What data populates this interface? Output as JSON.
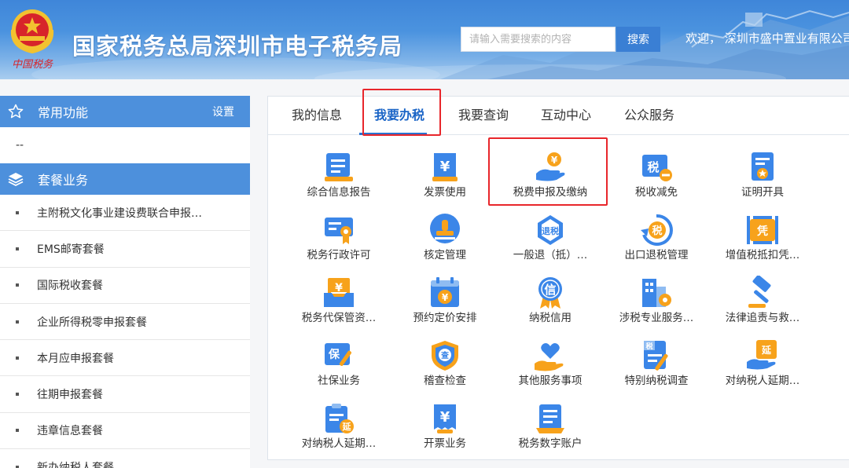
{
  "header": {
    "site_title": "国家税务总局深圳市电子税务局",
    "emblem_text": "中国税务",
    "search_placeholder": "请输入需要搜索的内容",
    "search_button": "搜索",
    "welcome": "欢迎， 深圳市盛中置业有限公司"
  },
  "sidebar": {
    "common_title": "常用功能",
    "settings_label": "设置",
    "common_placeholder": "--",
    "package_title": "套餐业务",
    "items": [
      "主附税文化事业建设费联合申报…",
      "EMS邮寄套餐",
      "国际税收套餐",
      "企业所得税零申报套餐",
      "本月应申报套餐",
      "往期申报套餐",
      "违章信息套餐",
      "新办纳税人套餐"
    ]
  },
  "tabs": [
    "我的信息",
    "我要办税",
    "我要查询",
    "互动中心",
    "公众服务"
  ],
  "active_tab": "我要办税",
  "functions": [
    {
      "label": "综合信息报告",
      "icon": "report-icon"
    },
    {
      "label": "发票使用",
      "icon": "invoice-icon"
    },
    {
      "label": "税费申报及缴纳",
      "icon": "hand-coin-icon"
    },
    {
      "label": "税收减免",
      "icon": "tax-minus-icon"
    },
    {
      "label": "证明开具",
      "icon": "certificate-icon"
    },
    {
      "label": "税务行政许可",
      "icon": "license-icon"
    },
    {
      "label": "核定管理",
      "icon": "stamp-icon"
    },
    {
      "label": "一般退（抵）…",
      "icon": "refund-shield-icon"
    },
    {
      "label": "出口退税管理",
      "icon": "export-refund-icon"
    },
    {
      "label": "增值税抵扣凭…",
      "icon": "voucher-icon"
    },
    {
      "label": "税务代保管资…",
      "icon": "custody-box-icon"
    },
    {
      "label": "预约定价安排",
      "icon": "calendar-coin-icon"
    },
    {
      "label": "纳税信用",
      "icon": "credit-medal-icon"
    },
    {
      "label": "涉税专业服务…",
      "icon": "building-gear-icon"
    },
    {
      "label": "法律追责与救…",
      "icon": "gavel-icon"
    },
    {
      "label": "社保业务",
      "icon": "social-security-icon"
    },
    {
      "label": "稽查检查",
      "icon": "inspection-shield-icon"
    },
    {
      "label": "其他服务事项",
      "icon": "heart-hand-icon"
    },
    {
      "label": "特别纳税调查",
      "icon": "special-tax-doc-icon"
    },
    {
      "label": "对纳税人延期…",
      "icon": "extension-hand-icon"
    },
    {
      "label": "对纳税人延期…",
      "icon": "extension-clipboard-icon"
    },
    {
      "label": "开票业务",
      "icon": "issue-invoice-icon"
    },
    {
      "label": "税务数字账户",
      "icon": "digital-account-icon"
    }
  ],
  "icon_glyphs": {
    "invoice": "¥",
    "refund": "退税",
    "export": "税",
    "voucher": "凭",
    "custody": "¥",
    "credit": "信",
    "social": "保",
    "inspect": "查",
    "special": "税",
    "extend": "延"
  },
  "colors": {
    "primary_blue": "#2f7be0",
    "icon_blue": "#3b86e8",
    "icon_orange": "#f7a21b",
    "highlight_red": "#e8262b",
    "sidebar_header": "#4d90dc"
  }
}
